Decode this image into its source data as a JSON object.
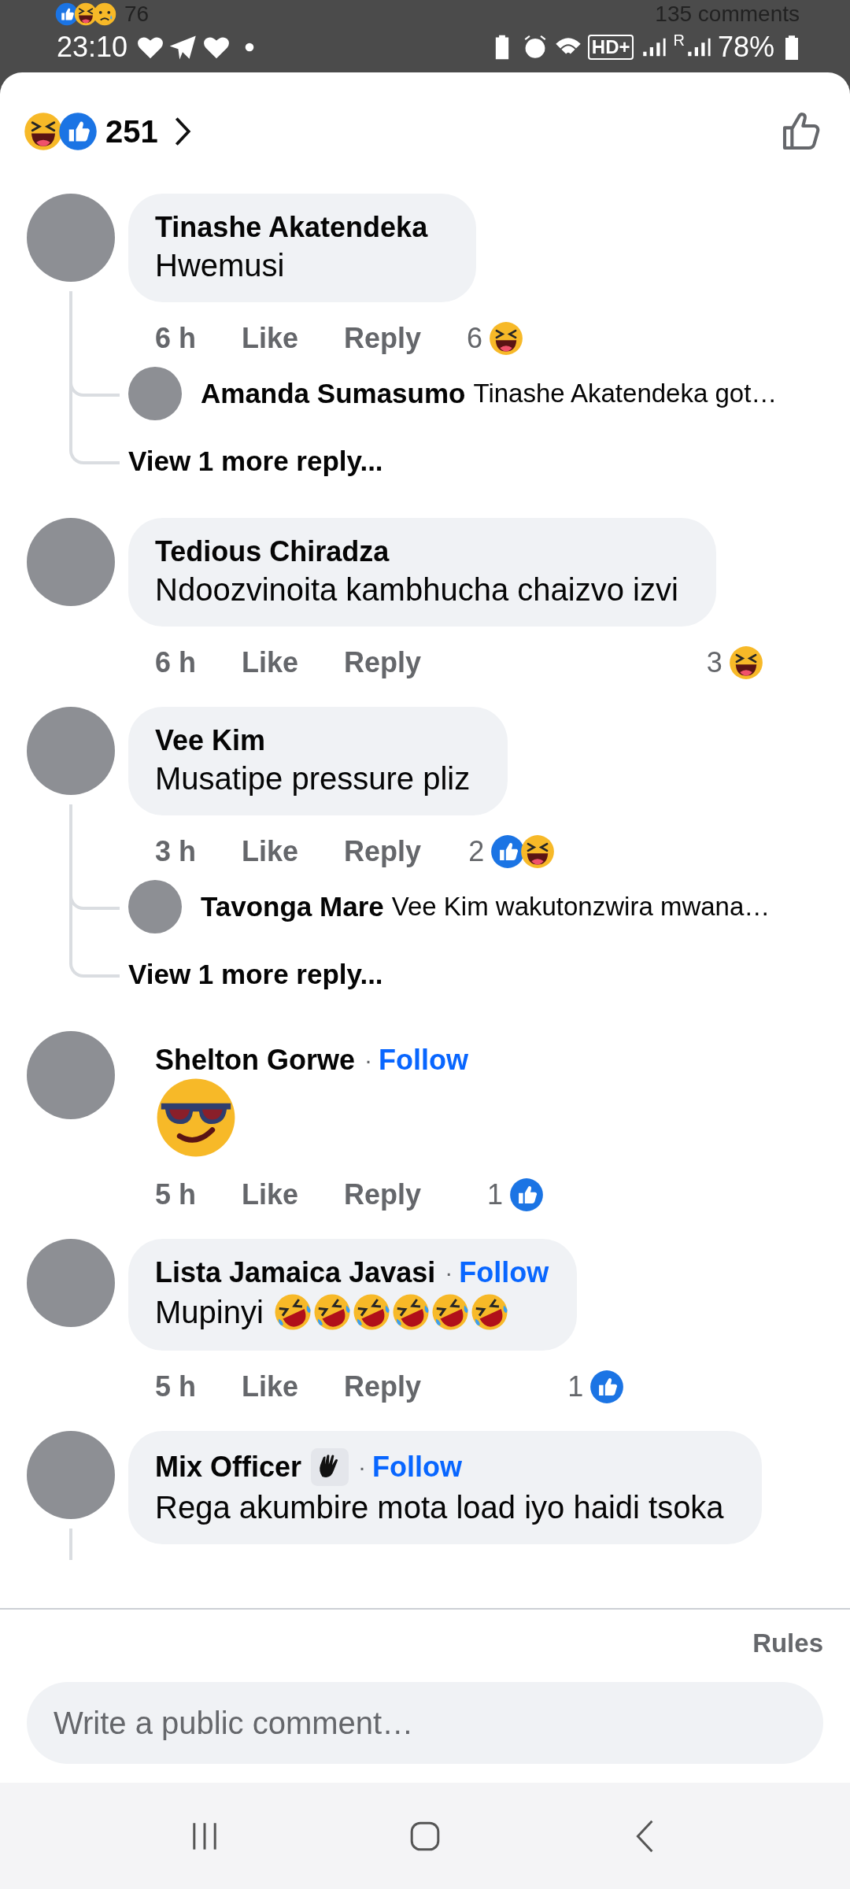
{
  "background_post": {
    "reactions": [
      {
        "kind": "like"
      },
      {
        "kind": "haha"
      },
      {
        "kind": "sad"
      }
    ],
    "reaction_count": "76",
    "comments_count": "135 comments"
  },
  "status_bar": {
    "time": "23:10",
    "network_label": "HD+",
    "roaming_label": "R",
    "battery": "78%"
  },
  "reactions_header": {
    "reactions": [
      {
        "kind": "haha"
      },
      {
        "kind": "like"
      }
    ],
    "count": "251"
  },
  "comments": [
    {
      "kind": "bubble",
      "author": "Tinashe Akatendeka",
      "text": "Hwemusi",
      "time": "6 h",
      "like": "Like",
      "reply": "Reply",
      "reaction_count": "6",
      "reactions": [
        {
          "kind": "haha"
        }
      ],
      "thread_line": true,
      "replies": [
        {
          "author": "Amanda Sumasumo",
          "text": "Tinashe Akatendeka got…"
        }
      ],
      "more_replies": "View 1 more reply..."
    },
    {
      "kind": "bubble",
      "author": "Tedious Chiradza",
      "text": "Ndoozvinoita kambhucha chaizvo izvi",
      "time": "6 h",
      "like": "Like",
      "reply": "Reply",
      "reaction_count": "3",
      "reactions": [
        {
          "kind": "haha"
        }
      ],
      "thread_line": false
    },
    {
      "kind": "bubble",
      "author": "Vee Kim",
      "text": "Musatipe pressure  pliz",
      "time": "3 h",
      "like": "Like",
      "reply": "Reply",
      "reaction_count": "2",
      "reactions": [
        {
          "kind": "like"
        },
        {
          "kind": "haha"
        }
      ],
      "thread_line": true,
      "replies": [
        {
          "author": "Tavonga Mare",
          "text": "Vee Kim wakutonzwira mwana…"
        }
      ],
      "more_replies": "View 1 more reply..."
    },
    {
      "kind": "emoji_only",
      "author": "Shelton Gorwe",
      "separator": "·",
      "follow": "Follow",
      "emojis": [
        {
          "kind": "sunglasses"
        }
      ],
      "time": "5 h",
      "like": "Like",
      "reply": "Reply",
      "reaction_count": "1",
      "reactions": [
        {
          "kind": "like"
        }
      ],
      "thread_line": false
    },
    {
      "kind": "bubble",
      "author": "Lista Jamaica Javasi",
      "separator": "·",
      "follow": "Follow",
      "text": "Mupinyi",
      "emojis": [
        {
          "kind": "rofl"
        },
        {
          "kind": "rofl"
        },
        {
          "kind": "rofl"
        },
        {
          "kind": "rofl"
        },
        {
          "kind": "rofl"
        },
        {
          "kind": "rofl"
        }
      ],
      "time": "5 h",
      "like": "Like",
      "reply": "Reply",
      "reaction_count": "1",
      "reactions": [
        {
          "kind": "like"
        }
      ],
      "thread_line": false
    },
    {
      "kind": "bubble",
      "author": "Mix Officer",
      "badge": {
        "kind": "wave"
      },
      "separator": "·",
      "follow": "Follow",
      "text": "Rega akumbire mota load iyo haidi tsoka",
      "thread_line": true
    }
  ],
  "footer": {
    "rules": "Rules",
    "placeholder": "Write a public comment…"
  }
}
